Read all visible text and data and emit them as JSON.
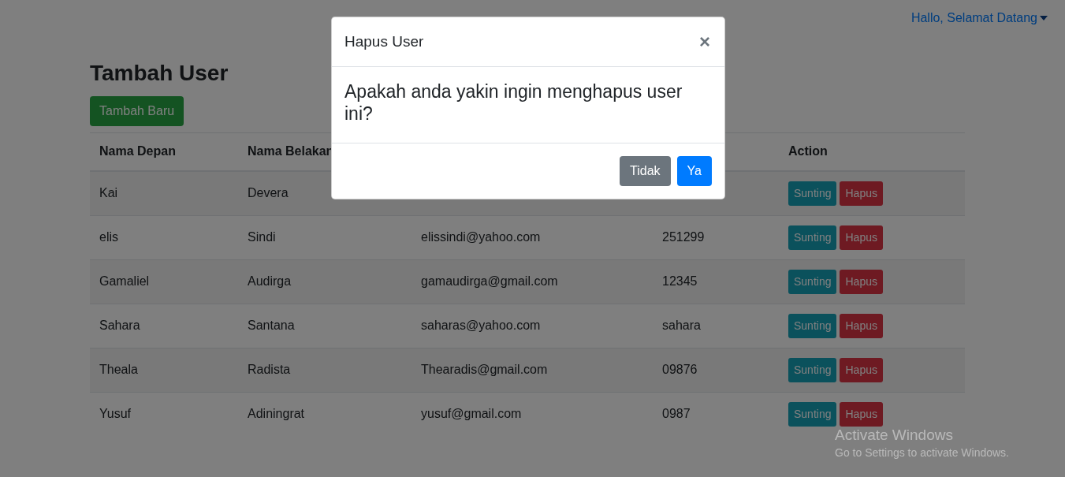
{
  "navbar": {
    "user_menu": "Hallo, Selamat Datang"
  },
  "page": {
    "title": "Tambah User",
    "add_button": "Tambah Baru"
  },
  "table": {
    "columns": [
      "Nama Depan",
      "Nama Belakan",
      "",
      "",
      "Action"
    ],
    "rows": [
      {
        "first_name": "Kai",
        "last_name": "Devera",
        "actions": [
          "Sunting",
          "Hapus"
        ]
      },
      {
        "first_name": "elis",
        "last_name": "Sindi",
        "email": "elissindi@yahoo.com",
        "password": "251299",
        "actions": [
          "Sunting",
          "Hapus"
        ]
      },
      {
        "first_name": "Gamaliel",
        "last_name": "Audirga",
        "email": "gamaudirga@gmail.com",
        "password": "12345",
        "actions": [
          "Sunting",
          "Hapus"
        ]
      },
      {
        "first_name": "Sahara",
        "last_name": "Santana",
        "email": "saharas@yahoo.com",
        "password": "sahara",
        "actions": [
          "Sunting",
          "Hapus"
        ]
      },
      {
        "first_name": "Theala",
        "last_name": "Radista",
        "email": "Thearadis@gmail.com",
        "password": "09876",
        "actions": [
          "Sunting",
          "Hapus"
        ]
      },
      {
        "first_name": "Yusuf",
        "last_name": "Adiningrat",
        "email": "yusuf@gmail.com",
        "password": "0987",
        "actions": [
          "Sunting",
          "Hapus"
        ]
      }
    ]
  },
  "modal": {
    "title": "Hapus User",
    "close": "×",
    "message": "Apakah anda yakin ingin menghapus user ini?",
    "buttons": [
      {
        "label": "Tidak",
        "kind": "secondary"
      },
      {
        "label": "Ya",
        "kind": "primary"
      }
    ]
  },
  "os_notice": {
    "title": "Activate Windows",
    "subtitle": "Go to Settings to activate Windows."
  }
}
